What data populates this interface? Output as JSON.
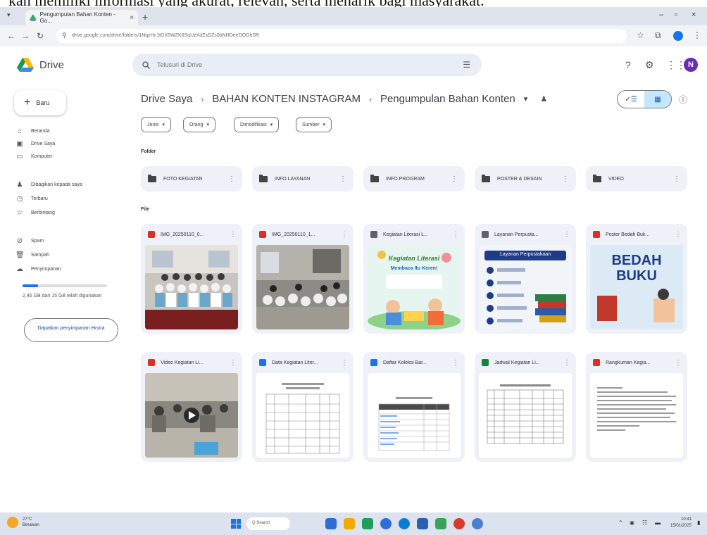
{
  "document_fragment": "kan memiliki informasi yang akurat, relevan, serta menarik bagi masyarakat.",
  "browser": {
    "tab_title": "Pengumpulan Bahan Konten - Go...",
    "url": "drive.google.com/drive/folders/1NqzHc1tGX5WZK6SqUzXdZsDZs0bNHDeeDOGhSR"
  },
  "drive": {
    "app_name": "Drive",
    "search_placeholder": "Telusuri di Drive",
    "avatar_initial": "N",
    "new_label": "Baru",
    "nav": [
      {
        "label": "Beranda",
        "icon": "home-icon"
      },
      {
        "label": "Drive Saya",
        "icon": "drive-icon"
      },
      {
        "label": "Komputer",
        "icon": "computer-icon"
      },
      {
        "label": "Dibagikan kepada saya",
        "icon": "people-icon"
      },
      {
        "label": "Terbaru",
        "icon": "clock-icon"
      },
      {
        "label": "Berbintang",
        "icon": "star-icon"
      },
      {
        "label": "Spam",
        "icon": "spam-icon"
      },
      {
        "label": "Sampah",
        "icon": "trash-icon"
      },
      {
        "label": "Penyimpanan",
        "icon": "cloud-icon"
      }
    ],
    "storage": {
      "used_fraction": 0.18,
      "text": "2,46 GB dari 15 GB telah digunakan"
    },
    "get_storage_label": "Dapatkan penyimpanan ekstra",
    "breadcrumb": [
      "Drive Saya",
      "BAHAN KONTEN INSTAGRAM",
      "Pengumpulan Bahan Konten"
    ],
    "filters": [
      "Jenis",
      "Orang",
      "Dimodifikasi",
      "Sumber"
    ],
    "folder_section": "Folder",
    "file_section": "File",
    "folders": [
      "FOTO KEGIATAN",
      "INFO LAYANAN",
      "INFO PROGRAM",
      "POSTER & DESAIN",
      "VIDEO"
    ],
    "files": [
      {
        "name": "IMG_20250110_0...",
        "type": "image",
        "color": "#d93025"
      },
      {
        "name": "IMG_20250110_1...",
        "type": "image",
        "color": "#d93025"
      },
      {
        "name": "Kegiatan Literasi L...",
        "type": "slides",
        "color": "#5f6368"
      },
      {
        "name": "Layanan Perpusta...",
        "type": "slides",
        "color": "#5f6368"
      },
      {
        "name": "Poster Bedah Buk...",
        "type": "image",
        "color": "#d93025"
      },
      {
        "name": "Video Kegiatan Li...",
        "type": "video",
        "color": "#d93025"
      },
      {
        "name": "Data Kegiatan Liter...",
        "type": "docs",
        "color": "#1a73e8"
      },
      {
        "name": "Daftar Koleksi Bar...",
        "type": "docs",
        "color": "#1a73e8"
      },
      {
        "name": "Jadwal Kegiatan Li...",
        "type": "sheets",
        "color": "#188038"
      },
      {
        "name": "Rangkuman Kegia...",
        "type": "pdf",
        "color": "#d93025"
      }
    ],
    "thumb_text": {
      "literasi_title": "Kegiatan Literasi",
      "literasi_sub": "Membaca Itu Keren!",
      "layanan_title": "Layanan Perpustakaan",
      "bedah_line1": "BEDAH",
      "bedah_line2": "BUKU"
    }
  },
  "taskbar": {
    "weather_temp": "27°C",
    "weather_desc": "Berawan",
    "search_label": "Q Search",
    "time": "10:41",
    "date": "15/01/2025"
  }
}
